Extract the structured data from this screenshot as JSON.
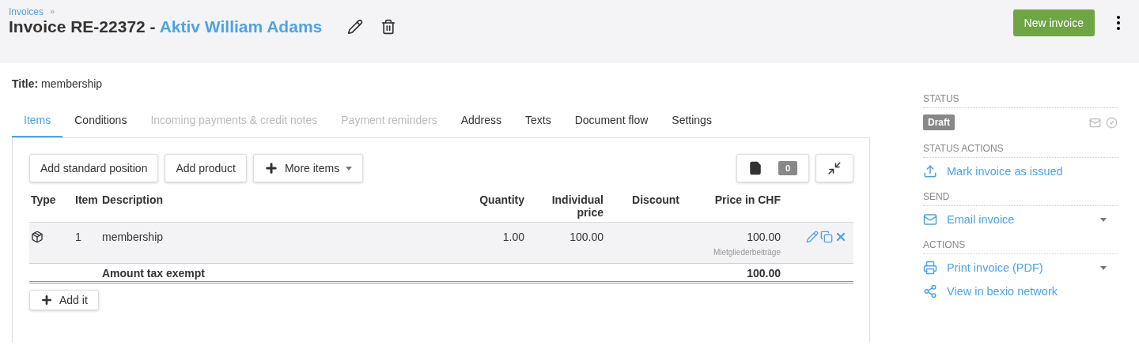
{
  "breadcrumb": {
    "label": "Invoices",
    "separator": "»"
  },
  "header": {
    "title": "Invoice RE-22372 - ",
    "contact": "Aktiv William Adams",
    "new_button": "New invoice"
  },
  "title_field": {
    "label": "Title:",
    "value": "membership"
  },
  "tabs": [
    {
      "label": "Items",
      "selected": true,
      "disabled": false
    },
    {
      "label": "Conditions",
      "selected": false,
      "disabled": false
    },
    {
      "label": "Incoming payments & credit notes",
      "selected": false,
      "disabled": true
    },
    {
      "label": "Payment reminders",
      "selected": false,
      "disabled": true
    },
    {
      "label": "Address",
      "selected": false,
      "disabled": false
    },
    {
      "label": "Texts",
      "selected": false,
      "disabled": false
    },
    {
      "label": "Document flow",
      "selected": false,
      "disabled": false
    },
    {
      "label": "Settings",
      "selected": false,
      "disabled": false
    }
  ],
  "toolbar": {
    "buttons": [
      {
        "label": "Add standard position",
        "kind": "plain"
      },
      {
        "label": "Add product",
        "kind": "plain"
      },
      {
        "label": "More items",
        "kind": "dropdown"
      }
    ],
    "file_count": "0"
  },
  "table": {
    "columns": [
      "Type",
      "Item",
      "Description",
      "Quantity",
      "Individual price",
      "Discount",
      "Price in CHF"
    ],
    "rows": [
      {
        "item": "1",
        "description": "membership",
        "quantity": "1.00",
        "individual_price": "100.00",
        "discount": "",
        "price": "100.00",
        "account": "Mietgliederbeiträge"
      }
    ],
    "total": {
      "label": "Amount tax exempt",
      "value": "100.00"
    }
  },
  "add_button": "Add it",
  "sidebar": {
    "status_heading": "STATUS",
    "status": "Draft",
    "sections": [
      {
        "heading": "STATUS ACTIONS",
        "actions": [
          {
            "label": "Mark invoice as issued",
            "kind": "upload",
            "dropdown": false
          }
        ]
      },
      {
        "heading": "SEND",
        "actions": [
          {
            "label": "Email invoice",
            "kind": "mail",
            "dropdown": true
          }
        ]
      },
      {
        "heading": "ACTIONS",
        "actions": [
          {
            "label": "Print invoice (PDF)",
            "kind": "print",
            "dropdown": true
          },
          {
            "label": "View in bexio network",
            "kind": "network",
            "dropdown": false
          }
        ]
      }
    ]
  }
}
